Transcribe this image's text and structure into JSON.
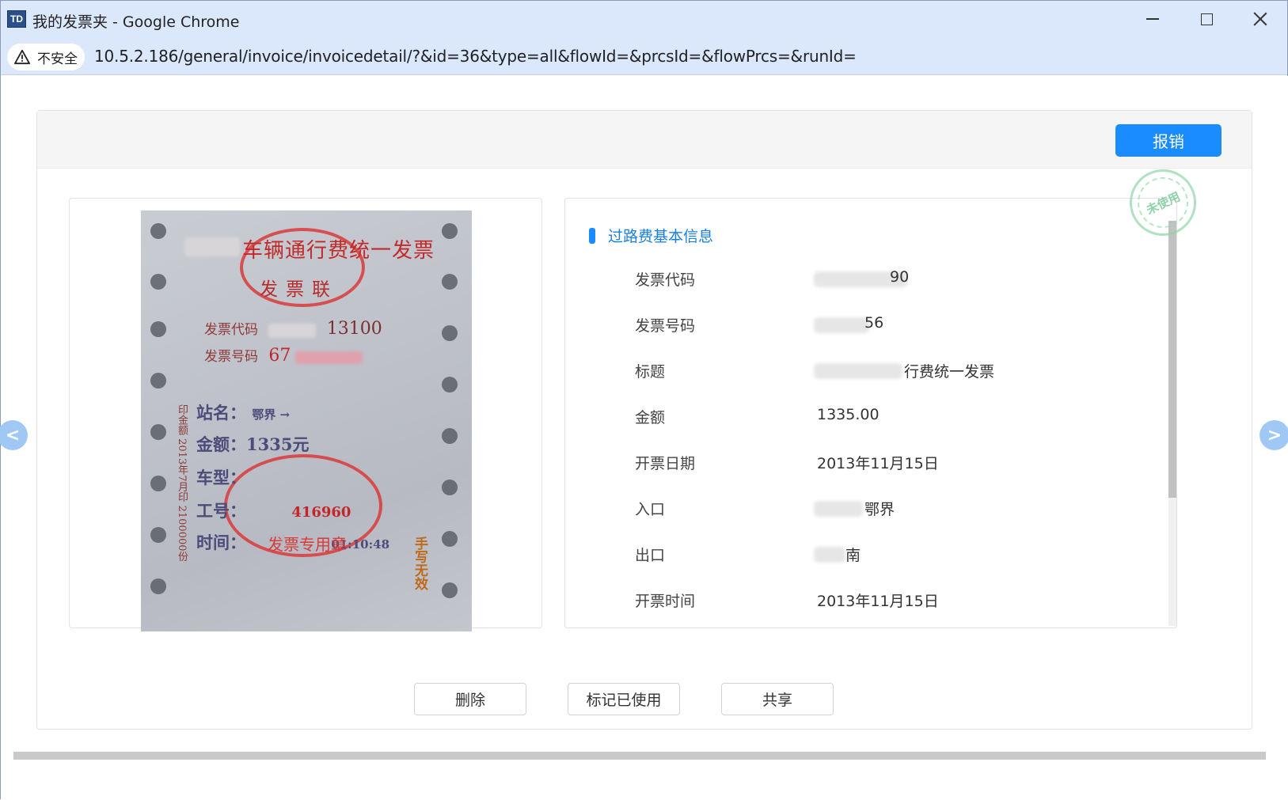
{
  "window": {
    "title": "我的发票夹 - Google Chrome",
    "app_icon_text": "TD"
  },
  "addressbar": {
    "security_label": "不安全",
    "url": "10.5.2.186/general/invoice/invoicedetail/?&id=36&type=all&flowId=&prcsId=&flowPrcs=&runId="
  },
  "header": {
    "reimburse_label": "报销"
  },
  "invoice_image": {
    "title": "车辆通行费统一发票",
    "subtitle": "发票联",
    "code_label": "发票代码",
    "code_value": "13100",
    "number_label": "发票号码",
    "number_value": "67",
    "station_label": "站名：",
    "station_value": "鄂界 →",
    "amount_line": "金额：1335元",
    "vehicle_label": "车型：",
    "worker_label": "工号：",
    "worker_value": "416960",
    "time_label": "时间：",
    "time_value": "01:10:48",
    "side_text": "印金额 2013年7月印 2100000份",
    "handwrite_note": "手写无效",
    "stamp_text": "发票专用章"
  },
  "info": {
    "section_title": "过路费基本信息",
    "stamp_label": "未使用",
    "rows": [
      {
        "label": "发票代码",
        "value": "90"
      },
      {
        "label": "发票号码",
        "value": "56"
      },
      {
        "label": "标题",
        "value": "行费统一发票"
      },
      {
        "label": "金额",
        "value": "1335.00"
      },
      {
        "label": "开票日期",
        "value": "2013年11月15日"
      },
      {
        "label": "入口",
        "value": "鄂界"
      },
      {
        "label": "出口",
        "value": "南"
      },
      {
        "label": "开票时间",
        "value": "2013年11月15日"
      }
    ]
  },
  "actions": {
    "delete_label": "删除",
    "mark_used_label": "标记已使用",
    "share_label": "共享"
  },
  "nav": {
    "prev_glyph": "<",
    "next_glyph": ">"
  },
  "colors": {
    "primary": "#1a8cff",
    "stamp_red": "#d93a3a",
    "unused_green": "#8fd6a8"
  }
}
